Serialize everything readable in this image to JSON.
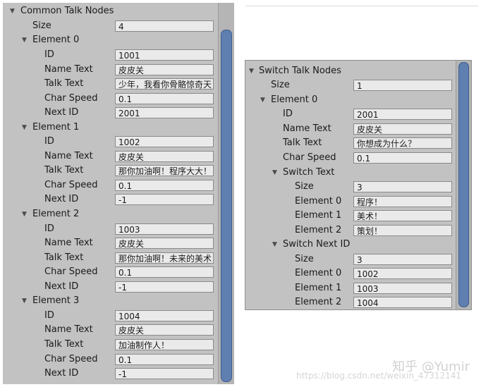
{
  "common": {
    "header": "Common Talk Nodes",
    "size_label": "Size",
    "size_value": "4",
    "elements": [
      {
        "title": "Element 0",
        "id_label": "ID",
        "id": "1001",
        "name_label": "Name Text",
        "name": "皮皮关",
        "talk_label": "Talk Text",
        "talk": "少年，我看你骨骼惊奇天",
        "speed_label": "Char Speed",
        "speed": "0.1",
        "next_label": "Next ID",
        "next": "2001"
      },
      {
        "title": "Element 1",
        "id_label": "ID",
        "id": "1002",
        "name_label": "Name Text",
        "name": "皮皮关",
        "talk_label": "Talk Text",
        "talk": "那你加油啊！程序大大！",
        "speed_label": "Char Speed",
        "speed": "0.1",
        "next_label": "Next ID",
        "next": "-1"
      },
      {
        "title": "Element 2",
        "id_label": "ID",
        "id": "1003",
        "name_label": "Name Text",
        "name": "皮皮关",
        "talk_label": "Talk Text",
        "talk": "那你加油啊！未来的美术",
        "speed_label": "Char Speed",
        "speed": "0.1",
        "next_label": "Next ID",
        "next": "-1"
      },
      {
        "title": "Element 3",
        "id_label": "ID",
        "id": "1004",
        "name_label": "Name Text",
        "name": "皮皮关",
        "talk_label": "Talk Text",
        "talk": "加油制作人！",
        "speed_label": "Char Speed",
        "speed": "0.1",
        "next_label": "Next ID",
        "next": "-1"
      }
    ]
  },
  "switch": {
    "header": "Switch Talk Nodes",
    "size_label": "Size",
    "size_value": "1",
    "element": {
      "title": "Element 0",
      "id_label": "ID",
      "id": "2001",
      "name_label": "Name Text",
      "name": "皮皮关",
      "talk_label": "Talk Text",
      "talk": "你想成为什么？",
      "speed_label": "Char Speed",
      "speed": "0.1",
      "switch_text": {
        "title": "Switch Text",
        "size_label": "Size",
        "size": "3",
        "items": [
          {
            "label": "Element 0",
            "value": "程序！"
          },
          {
            "label": "Element 1",
            "value": "美术！"
          },
          {
            "label": "Element 2",
            "value": "策划！"
          }
        ]
      },
      "switch_next": {
        "title": "Switch Next ID",
        "size_label": "Size",
        "size": "3",
        "items": [
          {
            "label": "Element 0",
            "value": "1002"
          },
          {
            "label": "Element 1",
            "value": "1003"
          },
          {
            "label": "Element 2",
            "value": "1004"
          }
        ]
      }
    }
  },
  "watermark": {
    "logo": "知乎 @Yumir",
    "url": "https://blog.csdn.net/weixin_47312141"
  },
  "icons": {
    "foldout": "triangle-down-icon"
  },
  "colors": {
    "panel_bg": "#c2c2c2",
    "field_bg": "#eaeaea",
    "scroll_thumb": "#5f7fb0"
  }
}
